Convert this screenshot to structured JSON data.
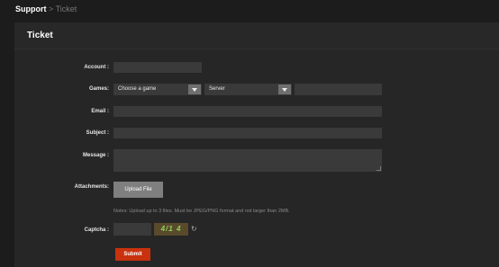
{
  "breadcrumb": {
    "current": "Support",
    "separator": ">",
    "page": "Ticket"
  },
  "panel": {
    "title": "Ticket"
  },
  "form": {
    "account_label": "Account :",
    "games_label": "Games:",
    "game_select": "Choose a game",
    "server_select": "Server",
    "email_label": "Email :",
    "subject_label": "Subject :",
    "message_label": "Message :",
    "attachments_label": "Attachments:",
    "upload_button": "Upload File",
    "notes": "Notes: Upload up to 3 files. Must be JPEG/PNG format and not larger than 2MB.",
    "captcha_label": "Captcha :",
    "captcha_image_text": "4/1 4",
    "refresh_icon": "↻",
    "submit_button": "Submit"
  },
  "icons": [
    "chevron-down-icon",
    "refresh-icon"
  ],
  "colors": {
    "accent": "#c8320e",
    "background": "#1c1c1c",
    "panel": "#262626",
    "input": "#3a3a3a"
  }
}
